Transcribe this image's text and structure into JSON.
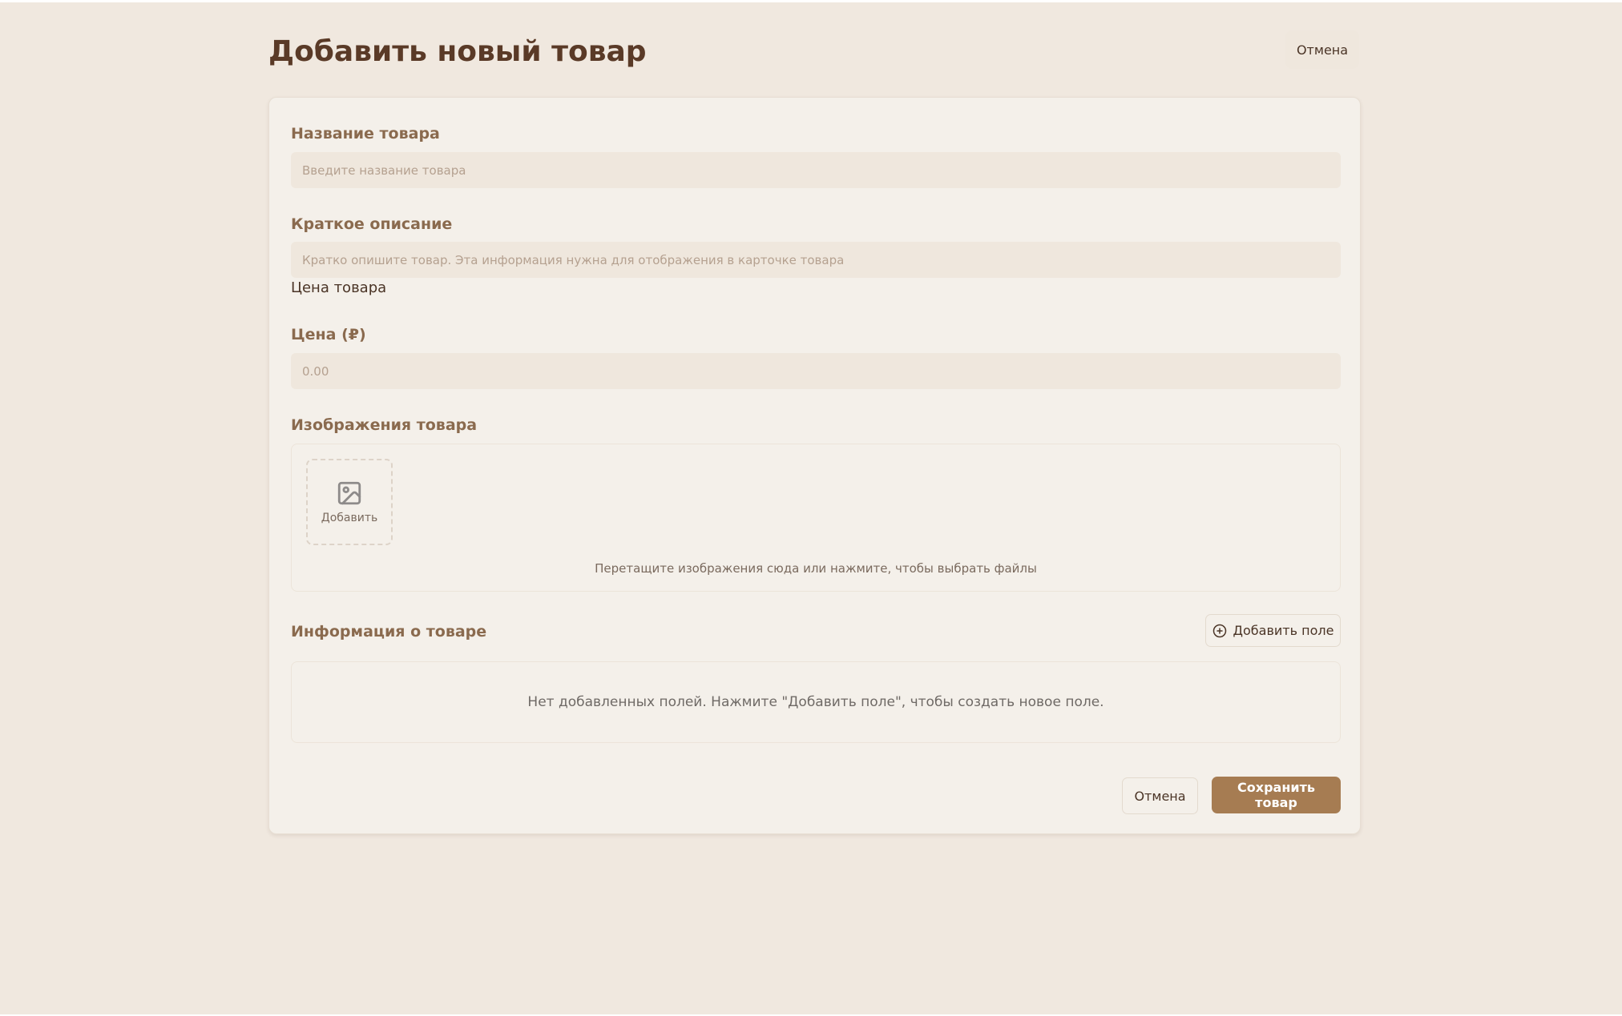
{
  "header": {
    "title": "Добавить новый товар",
    "cancel_label": "Отмена"
  },
  "form": {
    "name": {
      "label": "Название товара",
      "placeholder": "Введите название товара",
      "value": ""
    },
    "short_description": {
      "label": "Краткое описание",
      "placeholder": "Кратко опишите товар. Эта информация нужна для отображения в карточке товара",
      "value": ""
    },
    "price_section_label": "Цена товара",
    "price": {
      "label": "Цена (₽)",
      "placeholder": "0.00",
      "value": ""
    },
    "images": {
      "label": "Изображения товара",
      "add_label": "Добавить",
      "drop_hint": "Перетащите изображения сюда или нажмите, чтобы выбрать файлы",
      "icon": "image-icon"
    },
    "info": {
      "label": "Информация о товаре",
      "add_field_label": "Добавить поле",
      "add_field_icon": "plus-circle-icon",
      "empty_message": "Нет добавленных полей. Нажмите \"Добавить поле\", чтобы создать новое поле."
    }
  },
  "footer": {
    "cancel_label": "Отмена",
    "save_label": "Сохранить товар"
  },
  "colors": {
    "background": "#f0e8df",
    "card": "#f4f0ea",
    "title": "#5a3a27",
    "label": "#8a6a4e",
    "accent": "#a67c52"
  }
}
